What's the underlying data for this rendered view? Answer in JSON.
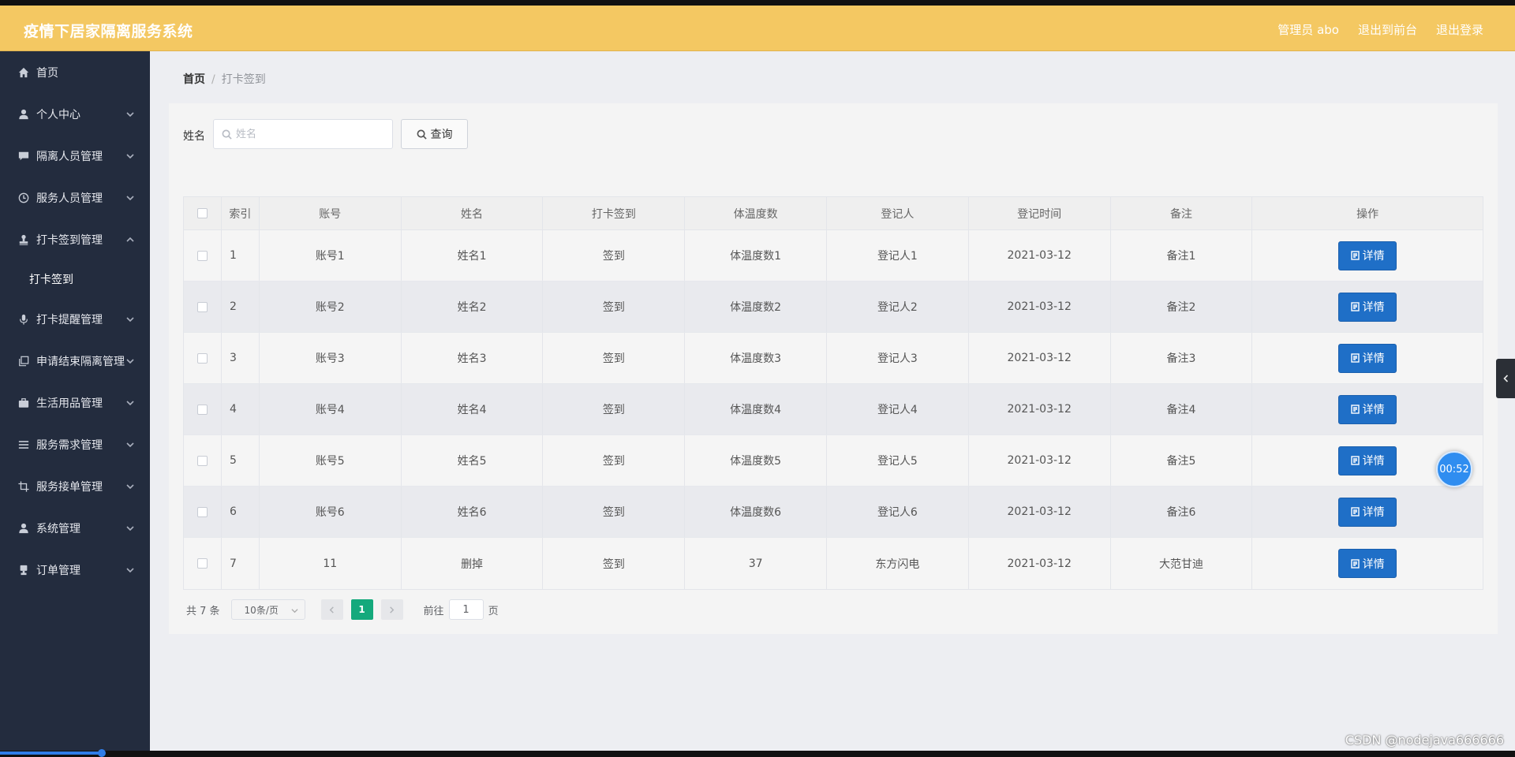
{
  "app": {
    "title": "疫情下居家隔离服务系统"
  },
  "header": {
    "user_label": "管理员 abo",
    "front_link": "退出到前台",
    "logout_link": "退出登录"
  },
  "sidebar": {
    "items": [
      {
        "label": "首页",
        "icon": "home-icon",
        "has_children": false
      },
      {
        "label": "个人中心",
        "icon": "user-icon",
        "has_children": true
      },
      {
        "label": "隔离人员管理",
        "icon": "chat-icon",
        "has_children": true
      },
      {
        "label": "服务人员管理",
        "icon": "clock-icon",
        "has_children": true
      },
      {
        "label": "打卡签到管理",
        "icon": "stamp-icon",
        "has_children": true,
        "expanded": true
      },
      {
        "label": "打卡提醒管理",
        "icon": "mic-icon",
        "has_children": true
      },
      {
        "label": "申请结束隔离管理",
        "icon": "copy-icon",
        "has_children": true
      },
      {
        "label": "生活用品管理",
        "icon": "briefcase-icon",
        "has_children": true
      },
      {
        "label": "服务需求管理",
        "icon": "list-icon",
        "has_children": true
      },
      {
        "label": "服务接单管理",
        "icon": "crop-icon",
        "has_children": true
      },
      {
        "label": "系统管理",
        "icon": "user-icon",
        "has_children": true
      },
      {
        "label": "订单管理",
        "icon": "stamp-icon",
        "has_children": true
      }
    ],
    "submenu": {
      "label": "打卡签到"
    }
  },
  "breadcrumb": {
    "home": "首页",
    "separator": "/",
    "current": "打卡签到"
  },
  "search": {
    "label": "姓名",
    "placeholder": "姓名",
    "button_label": "查询"
  },
  "table": {
    "headers": [
      "索引",
      "账号",
      "姓名",
      "打卡签到",
      "体温度数",
      "登记人",
      "登记时间",
      "备注",
      "操作"
    ],
    "rows": [
      {
        "index": "1",
        "account": "账号1",
        "name": "姓名1",
        "sign": "签到",
        "temp": "体温度数1",
        "registrar": "登记人1",
        "time": "2021-03-12",
        "note": "备注1",
        "action": "详情"
      },
      {
        "index": "2",
        "account": "账号2",
        "name": "姓名2",
        "sign": "签到",
        "temp": "体温度数2",
        "registrar": "登记人2",
        "time": "2021-03-12",
        "note": "备注2",
        "action": "详情"
      },
      {
        "index": "3",
        "account": "账号3",
        "name": "姓名3",
        "sign": "签到",
        "temp": "体温度数3",
        "registrar": "登记人3",
        "time": "2021-03-12",
        "note": "备注3",
        "action": "详情"
      },
      {
        "index": "4",
        "account": "账号4",
        "name": "姓名4",
        "sign": "签到",
        "temp": "体温度数4",
        "registrar": "登记人4",
        "time": "2021-03-12",
        "note": "备注4",
        "action": "详情"
      },
      {
        "index": "5",
        "account": "账号5",
        "name": "姓名5",
        "sign": "签到",
        "temp": "体温度数5",
        "registrar": "登记人5",
        "time": "2021-03-12",
        "note": "备注5",
        "action": "详情"
      },
      {
        "index": "6",
        "account": "账号6",
        "name": "姓名6",
        "sign": "签到",
        "temp": "体温度数6",
        "registrar": "登记人6",
        "time": "2021-03-12",
        "note": "备注6",
        "action": "详情"
      },
      {
        "index": "7",
        "account": "11",
        "name": "删掉",
        "sign": "签到",
        "temp": "37",
        "registrar": "东方闪电",
        "time": "2021-03-12",
        "note": "大范甘迪",
        "action": "详情"
      }
    ]
  },
  "pagination": {
    "total": "共 7 条",
    "page_size": "10条/页",
    "current_page": "1",
    "goto_prefix": "前往",
    "goto_value": "1",
    "goto_suffix": "页"
  },
  "overlay": {
    "timer": "00:52",
    "watermark": "CSDN @nodejava666666"
  },
  "colors": {
    "header_bg": "#f4c862",
    "sidebar_bg": "#232c3e",
    "primary_button": "#1f6fc7",
    "active_page": "#14a97c"
  }
}
